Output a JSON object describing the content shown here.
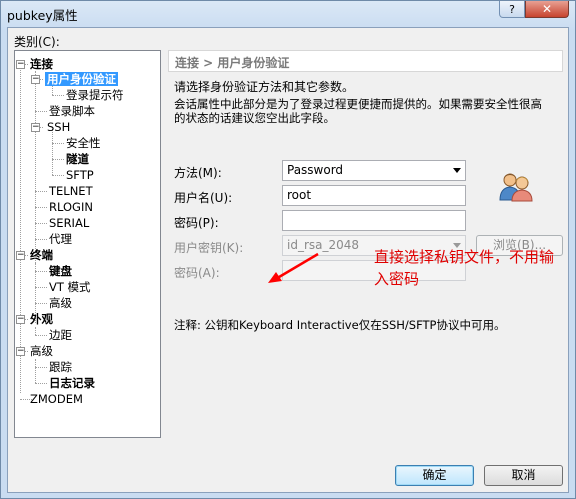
{
  "window": {
    "title": "pubkey属性",
    "help_label": "?",
    "close_label": "✕"
  },
  "category_label": "类别(C):",
  "tree": {
    "connection": "连接",
    "auth": "用户身份验证",
    "login_prompt": "登录提示符",
    "login_script": "登录脚本",
    "ssh": "SSH",
    "security": "安全性",
    "tunnel": "隧道",
    "sftp": "SFTP",
    "telnet": "TELNET",
    "rlogin": "RLOGIN",
    "serial": "SERIAL",
    "proxy": "代理",
    "terminal": "终端",
    "keyboard": "键盘",
    "vt_mode": "VT 模式",
    "advanced": "高级",
    "appearance": "外观",
    "margin": "边距",
    "advanced2": "高级",
    "trace": "跟踪",
    "logging": "日志记录",
    "zmodem": "ZMODEM",
    "expand_symbol": "−"
  },
  "panel": {
    "header": "连接 > 用户身份验证",
    "desc1": "请选择身份验证方法和其它参数。",
    "desc2": "会话属性中此部分是为了登录过程更便捷而提供的。如果需要安全性很高",
    "desc3": "的状态的话建议您空出此字段。",
    "method_label": "方法(M):",
    "method_value": "Password",
    "username_label": "用户名(U):",
    "username_value": "root",
    "password_label": "密码(P):",
    "password_value": "",
    "userkey_label": "用户密钥(K):",
    "userkey_value": "id_rsa_2048",
    "browse_label": "浏览(B)...",
    "passphrase_label": "密码(A):",
    "passphrase_value": "",
    "note": "注释: 公钥和Keyboard Interactive仅在SSH/SFTP协议中可用。"
  },
  "annotation": {
    "text": "直接选择私钥文件，不用输入密码",
    "color": "#e00000"
  },
  "buttons": {
    "ok": "确定",
    "cancel": "取消"
  }
}
